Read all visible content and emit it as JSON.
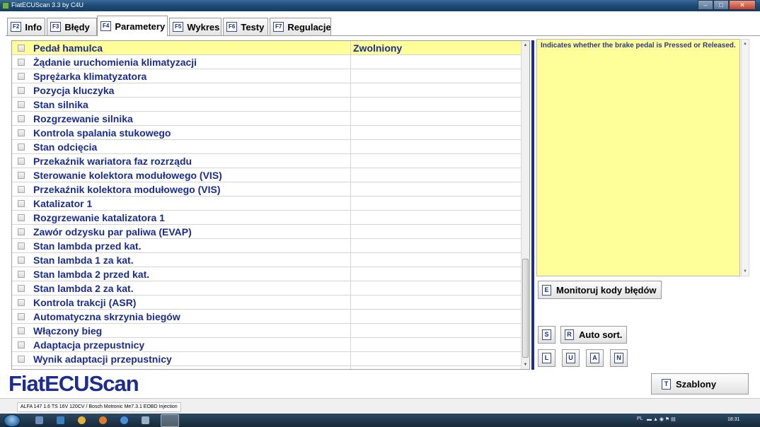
{
  "window": {
    "title": "FiatECUScan 3.3 by C4U",
    "buttons": {
      "minimize": "–",
      "maximize": "□",
      "close": "✕"
    }
  },
  "tabs": [
    {
      "key": "F2",
      "label": "Info"
    },
    {
      "key": "F3",
      "label": "Błędy"
    },
    {
      "key": "F4",
      "label": "Parametery",
      "active": true
    },
    {
      "key": "F5",
      "label": "Wykres"
    },
    {
      "key": "F6",
      "label": "Testy"
    },
    {
      "key": "F7",
      "label": "Regulacje"
    }
  ],
  "parameters": [
    {
      "name": "Pedał hamulca",
      "value": "Zwolniony"
    },
    {
      "name": "Żądanie uruchomienia klimatyzacji",
      "value": ""
    },
    {
      "name": "Sprężarka klimatyzatora",
      "value": ""
    },
    {
      "name": "Pozycja kluczyka",
      "value": ""
    },
    {
      "name": "Stan silnika",
      "value": ""
    },
    {
      "name": "Rozgrzewanie silnika",
      "value": ""
    },
    {
      "name": "Kontrola spalania stukowego",
      "value": ""
    },
    {
      "name": "Stan odcięcia",
      "value": ""
    },
    {
      "name": "Przekaźnik wariatora faz rozrządu",
      "value": ""
    },
    {
      "name": "Sterowanie kolektora modułowego (VIS)",
      "value": ""
    },
    {
      "name": "Przekaźnik kolektora modułowego (VIS)",
      "value": ""
    },
    {
      "name": "Katalizator 1",
      "value": ""
    },
    {
      "name": "Rozgrzewanie katalizatora 1",
      "value": ""
    },
    {
      "name": "Zawór odzysku par paliwa (EVAP)",
      "value": ""
    },
    {
      "name": "Stan lambda przed kat.",
      "value": ""
    },
    {
      "name": "Stan lambda 1 za kat.",
      "value": ""
    },
    {
      "name": "Stan lambda 2 przed kat.",
      "value": ""
    },
    {
      "name": "Stan lambda 2 za kat.",
      "value": ""
    },
    {
      "name": "Kontrola trakcji (ASR)",
      "value": ""
    },
    {
      "name": "Automatyczna skrzynia biegów",
      "value": ""
    },
    {
      "name": "Włączony bieg",
      "value": ""
    },
    {
      "name": "Adaptacja przepustnicy",
      "value": ""
    },
    {
      "name": "Wynik adaptacji przepustnicy",
      "value": ""
    }
  ],
  "selected_row": 0,
  "description": "Indicates whether the brake pedal is Pressed or Released.",
  "buttons": {
    "monitor": {
      "key": "E",
      "label": "Monitoruj kody błędów"
    },
    "s": {
      "key": "S"
    },
    "autosort": {
      "key": "R",
      "label": "Auto sort."
    },
    "l": {
      "key": "L"
    },
    "u": {
      "key": "U"
    },
    "a": {
      "key": "A"
    },
    "n": {
      "key": "N"
    },
    "szablony": {
      "key": "T",
      "label": "Szablony"
    }
  },
  "logo": "FiatECUScan",
  "status": "ALFA 147 1.6 TS 16V 120CV / Bosch Motronic Me7.3.1 EOBD Injection",
  "taskbar": {
    "lang": "PL",
    "clock": "18:31"
  },
  "colors": {
    "selected_row": "#ffff99",
    "text_blue": "#1a2c8c",
    "splitter": "#1c2f8c",
    "logo": "#1c2c90"
  }
}
